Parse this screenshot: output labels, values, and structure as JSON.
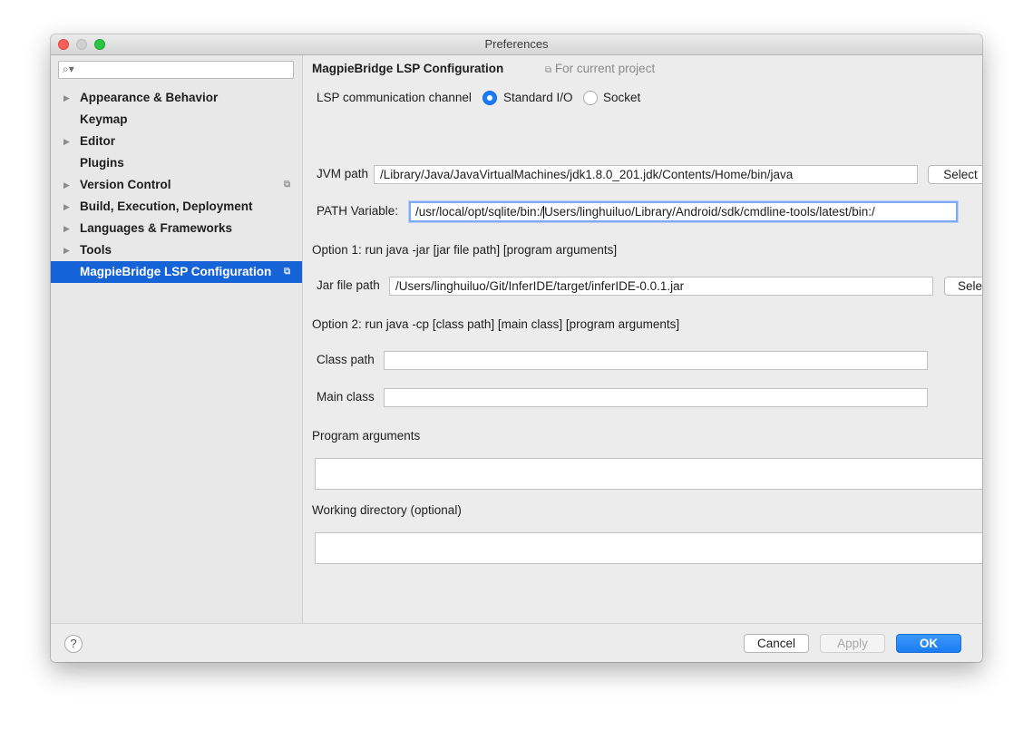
{
  "window": {
    "title": "Preferences"
  },
  "sidebar": {
    "search_value": "",
    "items": [
      {
        "label": "Appearance & Behavior",
        "expandable": true
      },
      {
        "label": "Keymap",
        "expandable": false
      },
      {
        "label": "Editor",
        "expandable": true
      },
      {
        "label": "Plugins",
        "expandable": false
      },
      {
        "label": "Version Control",
        "expandable": true,
        "project_scoped": true
      },
      {
        "label": "Build, Execution, Deployment",
        "expandable": true
      },
      {
        "label": "Languages & Frameworks",
        "expandable": true
      },
      {
        "label": "Tools",
        "expandable": true
      },
      {
        "label": "MagpieBridge LSP Configuration",
        "expandable": false,
        "project_scoped": true,
        "selected": true
      }
    ]
  },
  "main": {
    "heading": "MagpieBridge LSP Configuration",
    "scope_label": "For current project",
    "channel": {
      "label": "LSP communication channel",
      "options": [
        "Standard I/O",
        "Socket"
      ],
      "selected": "Standard I/O"
    },
    "jvm_path": {
      "label": "JVM path",
      "value": "/Library/Java/JavaVirtualMachines/jdk1.8.0_201.jdk/Contents/Home/bin/java",
      "button_label": "Select"
    },
    "path_variable": {
      "label": "PATH Variable:",
      "value_before_caret": "/usr/local/opt/sqlite/bin:/",
      "value_after_caret": "Users/linghuiluo/Library/Android/sdk/cmdline-tools/latest/bin:/"
    },
    "option1": {
      "heading": "Option 1: run java -jar [jar file path] [program arguments]",
      "jar_label": "Jar file path",
      "jar_value": "/Users/linghuiluo/Git/InferIDE/target/inferIDE-0.0.1.jar",
      "button_label": "Sele"
    },
    "option2": {
      "heading": "Option 2: run java -cp [class path] [main class] [program arguments]",
      "class_path_label": "Class path",
      "class_path_value": "",
      "main_class_label": "Main class",
      "main_class_value": ""
    },
    "program_arguments": {
      "label": "Program arguments",
      "value": ""
    },
    "working_directory": {
      "label": "Working directory (optional)",
      "value": ""
    }
  },
  "footer": {
    "help_label": "?",
    "cancel_label": "Cancel",
    "apply_label": "Apply",
    "ok_label": "OK"
  },
  "colors": {
    "selection": "#1662d7",
    "accent": "#1a7cf7",
    "focus_ring": "#7eaaf3"
  }
}
